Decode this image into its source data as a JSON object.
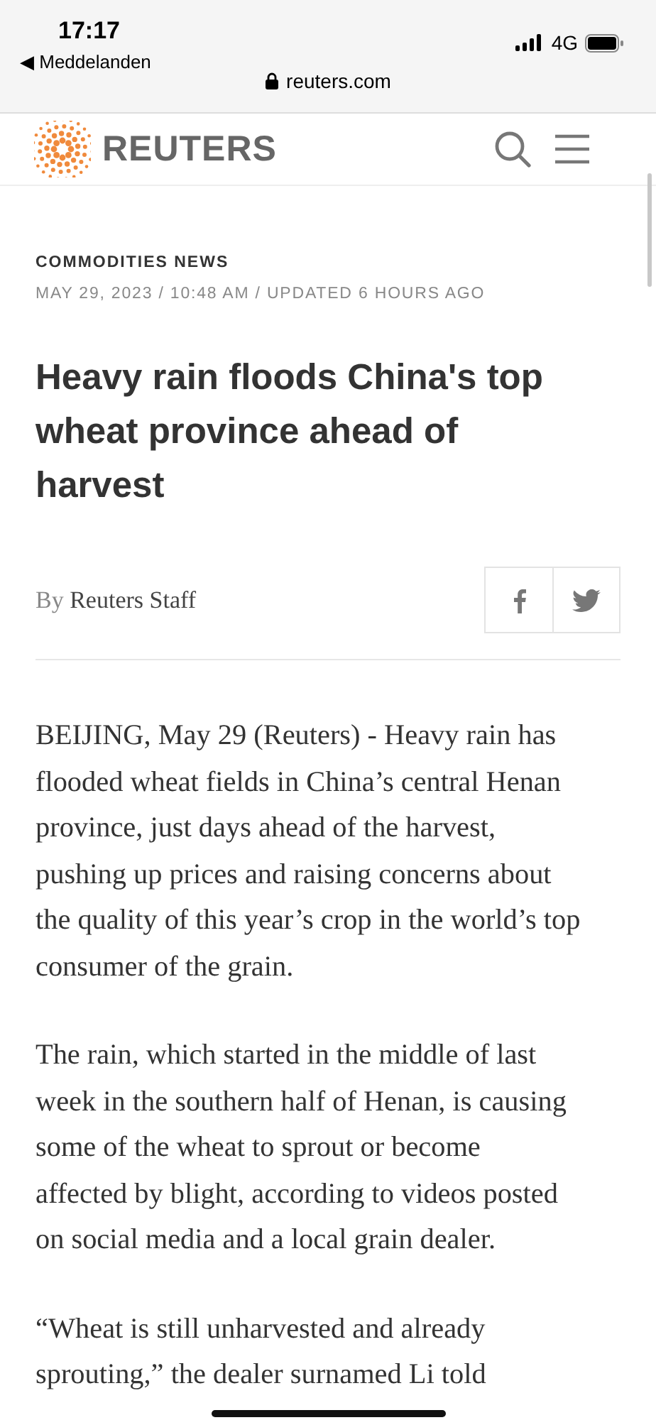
{
  "status_bar": {
    "time": "17:17",
    "back_app": "◀ Meddelanden",
    "network": "4G"
  },
  "address_bar": {
    "url": "reuters.com",
    "secure": true
  },
  "header": {
    "brand": "REUTERS"
  },
  "article": {
    "section": "COMMODITIES NEWS",
    "dateline": "MAY 29, 2023 / 10:48 AM / UPDATED 6 HOURS AGO",
    "headline": "Heavy rain floods China's top wheat province ahead of harvest",
    "byline_prefix": "By",
    "author": "Reuters Staff",
    "share": [
      {
        "kind": "facebook"
      },
      {
        "kind": "twitter"
      }
    ],
    "paragraphs": [
      [
        "BEIJING, May 29 (Reuters) - Heavy rain has",
        "flooded wheat fields in China’s central Henan",
        "province, just days ahead of the harvest,",
        "pushing up prices and raising concerns about",
        "the quality of this year’s crop in the world’s top",
        "consumer of the grain."
      ],
      [
        "The rain, which started in the middle of last",
        "week in the southern half of Henan, is causing",
        "some of the wheat to sprout or become",
        "affected by blight, according to videos posted",
        "on social media and a local grain dealer."
      ],
      [
        "“Wheat is still unharvested and already",
        "sprouting,” the dealer surnamed Li told"
      ]
    ]
  }
}
